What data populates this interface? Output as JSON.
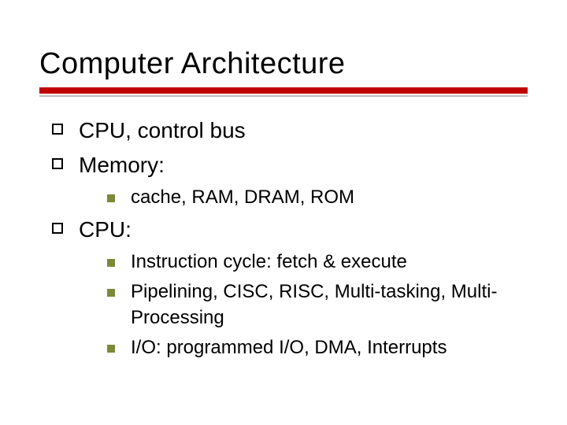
{
  "title": "Computer Architecture",
  "bullets": {
    "b0": "CPU, control bus",
    "b1": "Memory:",
    "b1_sub": {
      "s0": "cache, RAM, DRAM, ROM"
    },
    "b2": "CPU:",
    "b2_sub": {
      "s0": "Instruction cycle: fetch & execute",
      "s1": "Pipelining, CISC, RISC, Multi-tasking, Multi-Processing",
      "s2": "I/O: programmed I/O, DMA, Interrupts"
    }
  }
}
